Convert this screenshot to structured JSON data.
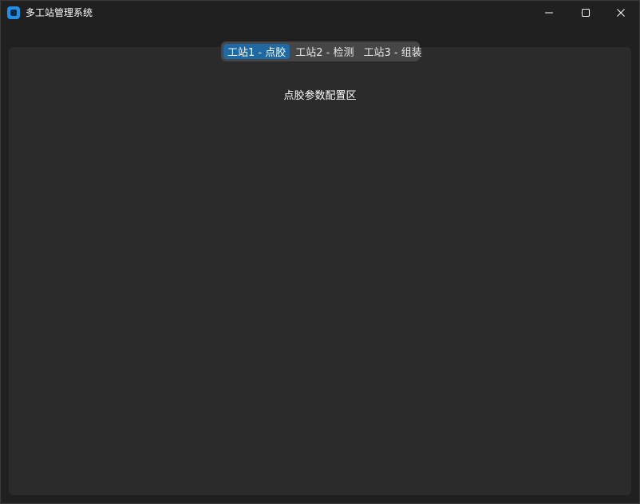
{
  "window": {
    "title": "多工站管理系统"
  },
  "titlebar_icons": {
    "minimize": "minimize-icon",
    "maximize": "maximize-icon",
    "close": "close-icon"
  },
  "tabs": [
    {
      "label": "工站1 - 点胶",
      "active": true
    },
    {
      "label": "工站2 - 检测",
      "active": false
    },
    {
      "label": "工站3 - 组装",
      "active": false
    }
  ],
  "panel": {
    "label": "点胶参数配置区"
  },
  "colors": {
    "accent": "#1f6aa5",
    "background": "#202020",
    "panel": "#2b2b2b",
    "tabbar": "#464646"
  }
}
